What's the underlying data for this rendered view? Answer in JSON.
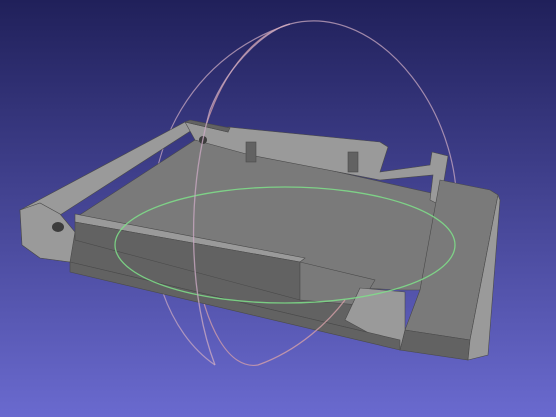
{
  "viewer": {
    "background_top": "#20205a",
    "background_bottom": "#6a6acf"
  },
  "model": {
    "face_color": "#808080",
    "top_color": "#7a7a7a",
    "side_light": "#9a9a9a",
    "side_dark": "#626262",
    "edge_color": "#4a4a4a",
    "hole_color": "#3c3c3c"
  },
  "trackball": {
    "horizontal_ring_color": "#7fe08a",
    "vertical_ring_color": "#c8a8c0",
    "side_ring_color": "#d6a0a8"
  },
  "icons": {
    "trackball": "trackball-gizmo-icon",
    "model": "3d-model-mesh-icon"
  }
}
